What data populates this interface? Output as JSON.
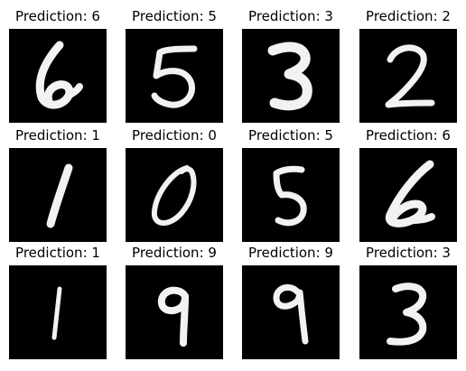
{
  "figure": {
    "background": "#ffffff",
    "image_background": "#000000",
    "stroke_color": "#f2f2f2",
    "panels": [
      {
        "title": "Prediction: 6",
        "digit": "6"
      },
      {
        "title": "Prediction: 5",
        "digit": "5"
      },
      {
        "title": "Prediction: 3",
        "digit": "3"
      },
      {
        "title": "Prediction: 2",
        "digit": "2"
      },
      {
        "title": "Prediction: 1",
        "digit": "1"
      },
      {
        "title": "Prediction: 0",
        "digit": "0"
      },
      {
        "title": "Prediction: 5",
        "digit": "5"
      },
      {
        "title": "Prediction: 6",
        "digit": "6"
      },
      {
        "title": "Prediction: 1",
        "digit": "1"
      },
      {
        "title": "Prediction: 9",
        "digit": "9"
      },
      {
        "title": "Prediction: 9",
        "digit": "9"
      },
      {
        "title": "Prediction: 3",
        "digit": "3"
      }
    ]
  }
}
